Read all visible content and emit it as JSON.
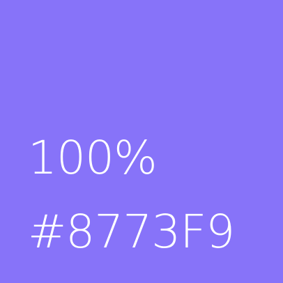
{
  "swatch": {
    "opacity_label": "100%",
    "hex_label": "#8773F9",
    "background_color": "#8773F9",
    "text_color": "#FFFFFF"
  }
}
